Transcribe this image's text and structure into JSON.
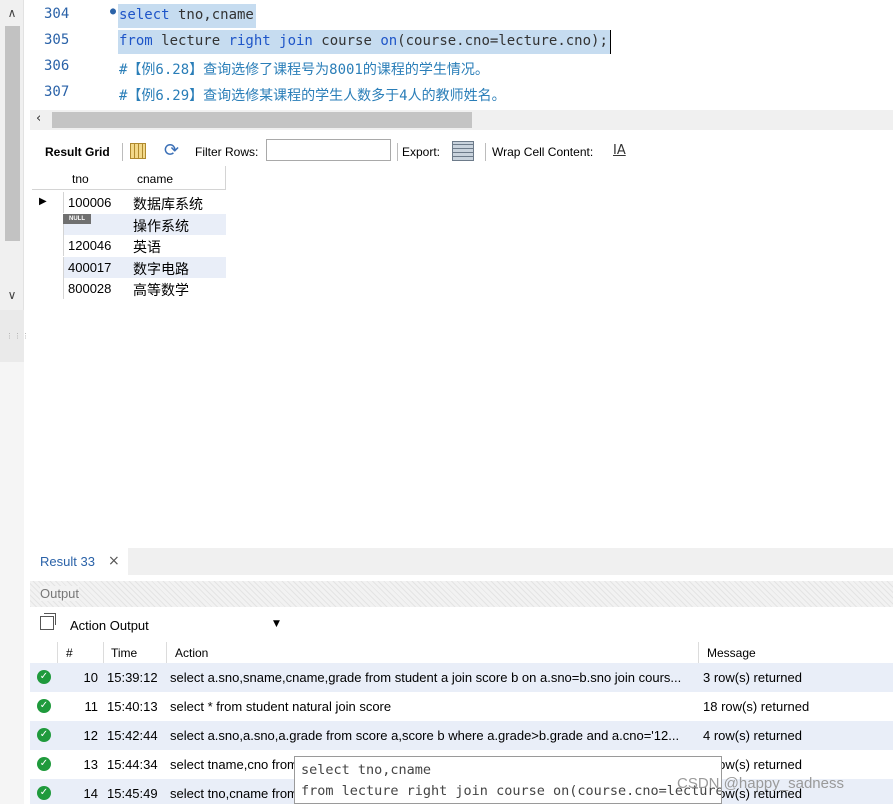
{
  "editor": {
    "lines": [
      {
        "num": "304",
        "marker": "●",
        "parts": [
          {
            "t": "select",
            "c": "kw"
          },
          {
            "t": " tno,cname",
            "c": ""
          }
        ]
      },
      {
        "num": "305",
        "marker": "",
        "parts": [
          {
            "t": "from",
            "c": "kw"
          },
          {
            "t": " lecture ",
            "c": ""
          },
          {
            "t": "right join",
            "c": "kw"
          },
          {
            "t": " course ",
            "c": ""
          },
          {
            "t": "on",
            "c": "kw"
          },
          {
            "t": "(course.cno=lecture.cno);",
            "c": ""
          }
        ]
      },
      {
        "num": "306",
        "marker": "",
        "parts": [
          {
            "t": "#【例6.28】查询选修了课程号为8001的课程的学生情况。",
            "c": "cm"
          }
        ]
      },
      {
        "num": "307",
        "marker": "",
        "parts": [
          {
            "t": "#【例6.29】查询选修某课程的学生人数多于4人的教师姓名。",
            "c": "cm"
          }
        ]
      }
    ]
  },
  "toolbar": {
    "result_grid": "Result Grid",
    "filter_rows": "Filter Rows:",
    "filter_value": "",
    "export": "Export:",
    "wrap": "Wrap Cell Content:"
  },
  "grid": {
    "columns": [
      "tno",
      "cname"
    ],
    "null_label": "NULL",
    "rows": [
      {
        "tno": "100006",
        "cname": "数据库系统",
        "current": true,
        "is_null": false
      },
      {
        "tno": "",
        "cname": "操作系统",
        "current": false,
        "is_null": true
      },
      {
        "tno": "120046",
        "cname": "英语",
        "current": false,
        "is_null": false
      },
      {
        "tno": "400017",
        "cname": "数字电路",
        "current": false,
        "is_null": false
      },
      {
        "tno": "800028",
        "cname": "高等数学",
        "current": false,
        "is_null": false
      }
    ]
  },
  "result_tab": {
    "label": "Result 33",
    "close": "×"
  },
  "output": {
    "title": "Output",
    "selector": "Action Output",
    "columns": {
      "num": "#",
      "time": "Time",
      "action": "Action",
      "message": "Message"
    },
    "rows": [
      {
        "num": "10",
        "time": "15:39:12",
        "action": "select a.sno,sname,cname,grade from student a join score b on a.sno=b.sno join cours...",
        "message": "3 row(s) returned"
      },
      {
        "num": "11",
        "time": "15:40:13",
        "action": "select * from student natural join score",
        "message": "18 row(s) returned"
      },
      {
        "num": "12",
        "time": "15:42:44",
        "action": "select a.sno,a.sno,a.grade from score a,score b where a.grade>b.grade and a.cno='12...",
        "message": "4 row(s) returned"
      },
      {
        "num": "13",
        "time": "15:44:34",
        "action": "select tname,cno from",
        "message": "0 row(s) returned"
      },
      {
        "num": "14",
        "time": "15:45:49",
        "action": "select tno,cname from",
        "message": "5 row(s) returned"
      }
    ]
  },
  "tooltip": {
    "line1": "select tno,cname",
    "line2": "from lecture right join course on(course.cno=lecture.cno)"
  },
  "watermark": "CSDN @happy_sadness",
  "colors": {
    "keyword": "#1e55c8",
    "comment": "#2a7eb8",
    "selection": "#c6dcf0",
    "alt_row": "#e9eef8",
    "ok_green": "#1f9a3c"
  }
}
